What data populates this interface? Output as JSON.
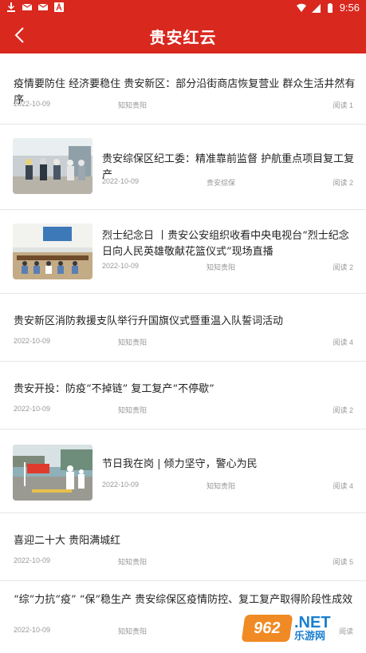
{
  "status_bar": {
    "time": "9:56"
  },
  "header": {
    "title": "贵安红云"
  },
  "articles": [
    {
      "title": "疫情要防住 经济要稳住 贵安新区：部分沿街商店恢复营业 群众生活井然有序",
      "date": "2022-10-09",
      "source": "知知贵阳",
      "reads": "阅读 1",
      "thumb": null
    },
    {
      "title": "贵安综保区纪工委：精准靠前监督 护航重点项目复工复产",
      "date": "2022-10-09",
      "source": "贵安综保",
      "reads": "阅读 2",
      "thumb": "workers-site-photo"
    },
    {
      "title": "烈士纪念日 丨贵安公安组织收看中央电视台“烈士纪念日向人民英雄敬献花篮仪式”现场直播",
      "date": "2022-10-09",
      "source": "知知贵阳",
      "reads": "阅读 2",
      "thumb": "meeting-room-photo"
    },
    {
      "title": "贵安新区消防救援支队举行升国旗仪式暨重温入队誓词活动",
      "date": "2022-10-09",
      "source": "知知贵阳",
      "reads": "阅读 4",
      "thumb": null
    },
    {
      "title": "贵安开投：防疫“不掉链” 复工复产“不停歇”",
      "date": "2022-10-09",
      "source": "知知贵阳",
      "reads": "阅读 2",
      "thumb": null
    },
    {
      "title": "节日我在岗 | 倾力坚守，警心为民",
      "date": "2022-10-09",
      "source": "知知贵阳",
      "reads": "阅读 4",
      "thumb": "police-checkpoint-photo"
    },
    {
      "title": "喜迎二十大 贵阳满城红",
      "date": "2022-10-09",
      "source": "知知贵阳",
      "reads": "阅读 5",
      "thumb": null
    },
    {
      "title": "“综”力抗“疫” “保”稳生产 贵安综保区疫情防控、复工复产取得阶段性成效",
      "date": "2022-10-09",
      "source": "知知贵阳",
      "reads": "阅读 ",
      "thumb": null
    }
  ],
  "watermark": {
    "badge": "962",
    "net": ".NET",
    "cn": "乐游网"
  },
  "colors": {
    "brand_red": "#d9281e",
    "text": "#222222",
    "meta": "#999999",
    "divider": "#e6e6e6"
  },
  "icons": [
    "download-icon",
    "mail-icon",
    "a-badge-icon",
    "image-icon",
    "wifi-icon",
    "sim-x-icon",
    "battery-icon",
    "back-chevron-icon"
  ]
}
